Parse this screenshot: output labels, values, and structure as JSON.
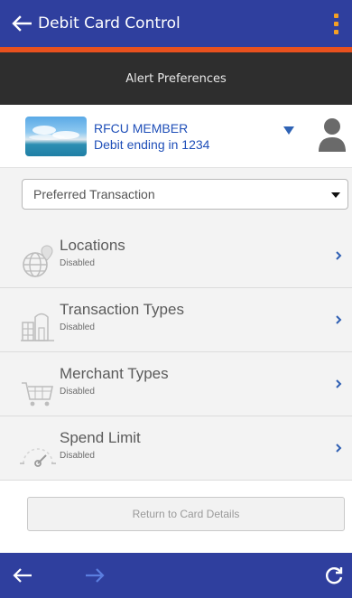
{
  "header": {
    "title": "Debit Card Control",
    "back_icon": "arrow-left-icon",
    "menu_icon": "kebab-menu-icon",
    "accent_color": "#e8511e",
    "bar_color": "#2f3f9e"
  },
  "subheader": {
    "title": "Alert Preferences"
  },
  "account": {
    "name": "RFCU MEMBER",
    "card": "Debit ending in 1234",
    "dropdown_icon": "caret-down-icon",
    "user_icon": "user-icon"
  },
  "preference_select": {
    "value": "Preferred Transaction"
  },
  "controls": [
    {
      "label": "Locations",
      "status": "Disabled",
      "icon": "globe-pin-icon"
    },
    {
      "label": "Transaction Types",
      "status": "Disabled",
      "icon": "storefront-icon"
    },
    {
      "label": "Merchant Types",
      "status": "Disabled",
      "icon": "shopping-cart-icon"
    },
    {
      "label": "Spend Limit",
      "status": "Disabled",
      "icon": "speedometer-icon"
    }
  ],
  "footer": {
    "return_label": "Return to Card Details"
  },
  "bottom_nav": {
    "back_icon": "arrow-left-icon",
    "forward_icon": "arrow-right-icon",
    "refresh_icon": "refresh-icon"
  }
}
